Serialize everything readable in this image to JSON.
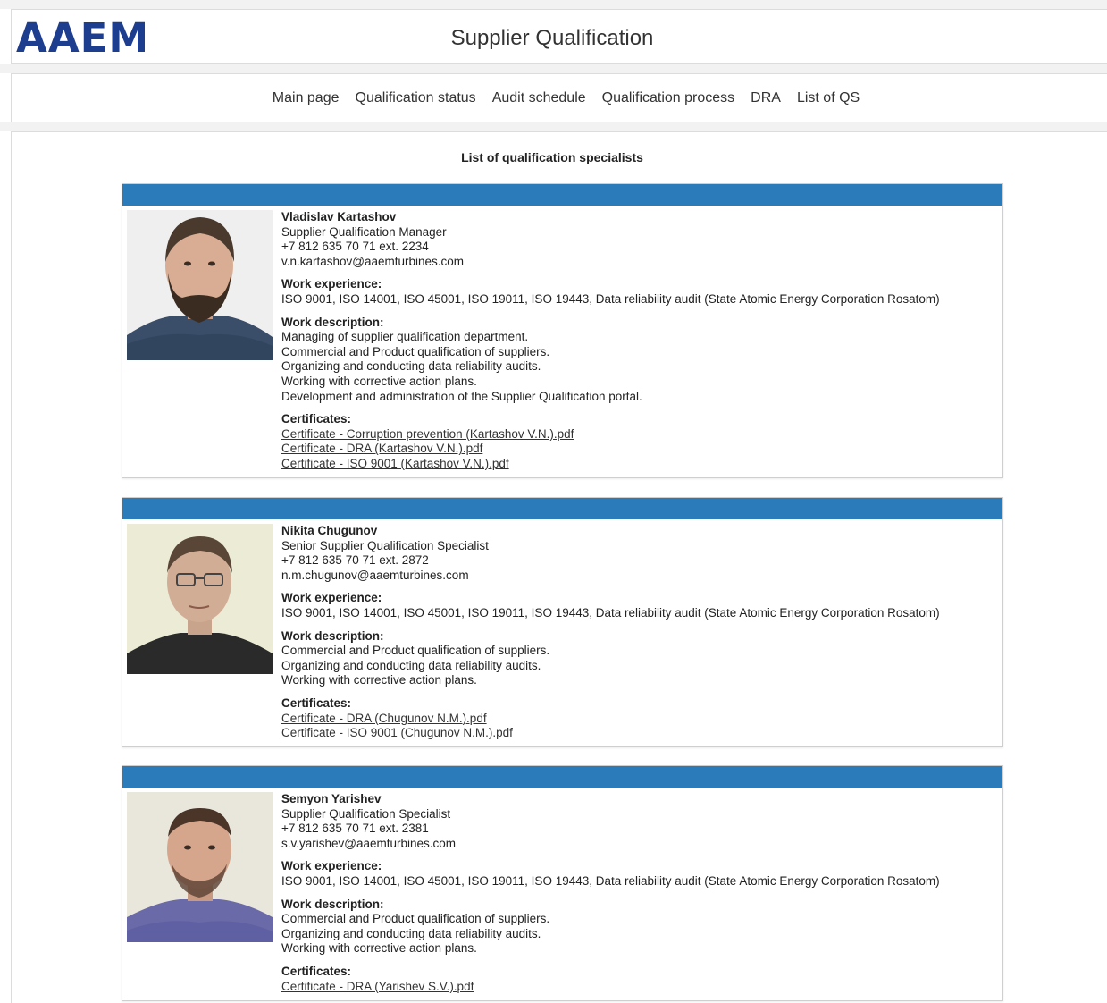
{
  "header": {
    "logo_text": "AAEM",
    "title": "Supplier Qualification"
  },
  "nav": {
    "items": [
      "Main page",
      "Qualification status",
      "Audit schedule",
      "Qualification process",
      "DRA",
      "List of QS"
    ]
  },
  "page": {
    "heading": "List of qualification specialists"
  },
  "labels": {
    "work_experience": "Work experience:",
    "work_description": "Work description:",
    "certificates": "Certificates:"
  },
  "specialists": [
    {
      "name": "Vladislav Kartashov",
      "position": "Supplier Qualification Manager",
      "phone": "+7 812 635 70 71 ext. 2234",
      "email": "v.n.kartashov@aaemturbines.com",
      "experience": "ISO 9001, ISO 14001, ISO 45001, ISO 19011, ISO 19443, Data reliability audit (State Atomic Energy Corporation Rosatom)",
      "description": [
        "Managing of supplier qualification department.",
        "Commercial and Product qualification of suppliers.",
        "Organizing and conducting data reliability audits.",
        "Working with corrective action plans.",
        "Development and administration of the Supplier Qualification portal."
      ],
      "certificates": [
        "Certificate - Corruption prevention (Kartashov V.N.).pdf",
        "Certificate - DRA (Kartashov V.N.).pdf",
        "Certificate - ISO 9001 (Kartashov V.N.).pdf"
      ]
    },
    {
      "name": "Nikita Chugunov",
      "position": "Senior Supplier Qualification Specialist",
      "phone": "+7 812 635 70 71 ext. 2872",
      "email": "n.m.chugunov@aaemturbines.com",
      "experience": "ISO 9001, ISO 14001, ISO 45001, ISO 19011, ISO 19443, Data reliability audit (State Atomic Energy Corporation Rosatom)",
      "description": [
        "Commercial and Product qualification of suppliers.",
        "Organizing and conducting data reliability audits.",
        "Working with corrective action plans."
      ],
      "certificates": [
        "Certificate - DRA (Chugunov N.M.).pdf",
        "Certificate - ISO 9001 (Chugunov N.M.).pdf"
      ]
    },
    {
      "name": "Semyon Yarishev",
      "position": "Supplier Qualification Specialist",
      "phone": "+7 812 635 70 71 ext. 2381",
      "email": "s.v.yarishev@aaemturbines.com",
      "experience": "ISO 9001, ISO 14001, ISO 45001, ISO 19011, ISO 19443, Data reliability audit (State Atomic Energy Corporation Rosatom)",
      "description": [
        "Commercial and Product qualification of suppliers.",
        "Organizing and conducting data reliability audits.",
        "Working with corrective action plans."
      ],
      "certificates": [
        "Certificate - DRA (Yarishev S.V.).pdf"
      ]
    }
  ],
  "colors": {
    "logo": "#1d3d8f",
    "card_bar": "#2b7bbb"
  }
}
